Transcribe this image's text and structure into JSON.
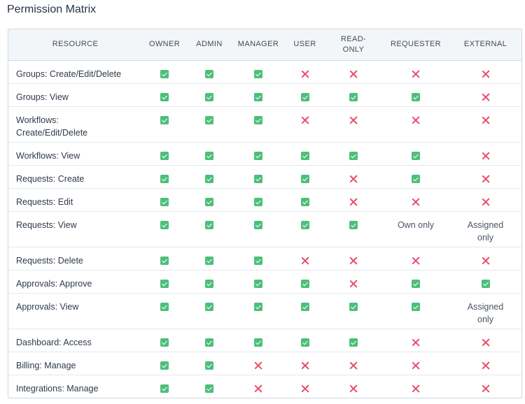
{
  "title": "Permission Matrix",
  "columns": {
    "resource": "RESOURCE",
    "owner": "OWNER",
    "admin": "ADMIN",
    "manager": "MANAGER",
    "user": "USER",
    "read_only": "READ-ONLY",
    "requester": "REQUESTER",
    "external": "EXTERNAL"
  },
  "status_icons": {
    "yes": "checkbox-checked-icon",
    "no": "cross-icon"
  },
  "colors": {
    "allowed": "#4cbf7a",
    "denied": "#e94e6a"
  },
  "rows": [
    {
      "resource": "Groups: Create/Edit/Delete",
      "values": [
        "yes",
        "yes",
        "yes",
        "no",
        "no",
        "no",
        "no"
      ]
    },
    {
      "resource": "Groups: View",
      "values": [
        "yes",
        "yes",
        "yes",
        "yes",
        "yes",
        "yes",
        "no"
      ]
    },
    {
      "resource": "Workflows: Create/Edit/Delete",
      "values": [
        "yes",
        "yes",
        "yes",
        "no",
        "no",
        "no",
        "no"
      ]
    },
    {
      "resource": "Workflows: View",
      "values": [
        "yes",
        "yes",
        "yes",
        "yes",
        "yes",
        "yes",
        "no"
      ]
    },
    {
      "resource": "Requests: Create",
      "values": [
        "yes",
        "yes",
        "yes",
        "yes",
        "no",
        "yes",
        "no"
      ]
    },
    {
      "resource": "Requests: Edit",
      "values": [
        "yes",
        "yes",
        "yes",
        "yes",
        "no",
        "no",
        "no"
      ]
    },
    {
      "resource": "Requests: View",
      "values": [
        "yes",
        "yes",
        "yes",
        "yes",
        "yes",
        "Own only",
        "Assigned only"
      ]
    },
    {
      "resource": "Requests: Delete",
      "values": [
        "yes",
        "yes",
        "yes",
        "no",
        "no",
        "no",
        "no"
      ]
    },
    {
      "resource": "Approvals: Approve",
      "values": [
        "yes",
        "yes",
        "yes",
        "yes",
        "no",
        "yes",
        "yes"
      ]
    },
    {
      "resource": "Approvals: View",
      "values": [
        "yes",
        "yes",
        "yes",
        "yes",
        "yes",
        "yes",
        "Assigned only"
      ]
    },
    {
      "resource": "Dashboard: Access",
      "values": [
        "yes",
        "yes",
        "yes",
        "yes",
        "yes",
        "no",
        "no"
      ]
    },
    {
      "resource": "Billing: Manage",
      "values": [
        "yes",
        "yes",
        "no",
        "no",
        "no",
        "no",
        "no"
      ]
    },
    {
      "resource": "Integrations: Manage",
      "values": [
        "yes",
        "yes",
        "no",
        "no",
        "no",
        "no",
        "no"
      ]
    }
  ]
}
